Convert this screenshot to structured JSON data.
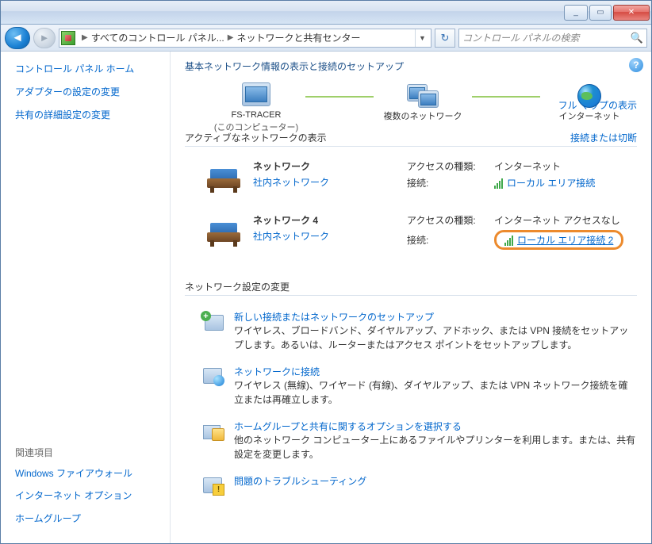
{
  "titlebar": {
    "min": "_",
    "max": "▭",
    "close": "✕"
  },
  "address": {
    "crumb1": "すべてのコントロール パネル...",
    "crumb2": "ネットワークと共有センター",
    "search_placeholder": "コントロール パネルの検索"
  },
  "sidebar": {
    "home": "コントロール パネル ホーム",
    "adapter": "アダプターの設定の変更",
    "sharing": "共有の詳細設定の変更",
    "related_heading": "関連項目",
    "firewall": "Windows ファイアウォール",
    "inetopt": "インターネット オプション",
    "homegroup": "ホームグループ"
  },
  "main": {
    "h1": "基本ネットワーク情報の表示と接続のセットアップ",
    "map": {
      "node1": "FS-TRACER",
      "node1_sub": "(このコンピューター)",
      "node2": "複数のネットワーク",
      "node3": "インターネット",
      "fullmap": "フル マップの表示"
    },
    "active_heading": "アクティブなネットワークの表示",
    "active_link": "接続または切断",
    "net1": {
      "name": "ネットワーク",
      "type": "社内ネットワーク",
      "access_label": "アクセスの種類:",
      "access_val": "インターネット",
      "conn_label": "接続:",
      "conn_link": "ローカル エリア接続"
    },
    "net2": {
      "name": "ネットワーク  4",
      "type": "社内ネットワーク",
      "access_label": "アクセスの種類:",
      "access_val": "インターネット アクセスなし",
      "conn_label": "接続:",
      "conn_link": "ローカル エリア接続 2"
    },
    "settings_heading": "ネットワーク設定の変更",
    "s1": {
      "title": "新しい接続またはネットワークのセットアップ",
      "desc": "ワイヤレス、ブロードバンド、ダイヤルアップ、アドホック、または VPN 接続をセットアップします。あるいは、ルーターまたはアクセス ポイントをセットアップします。"
    },
    "s2": {
      "title": "ネットワークに接続",
      "desc": "ワイヤレス (無線)、ワイヤード (有線)、ダイヤルアップ、または VPN ネットワーク接続を確立または再確立します。"
    },
    "s3": {
      "title": "ホームグループと共有に関するオプションを選択する",
      "desc": "他のネットワーク コンピューター上にあるファイルやプリンターを利用します。または、共有設定を変更します。"
    },
    "s4": {
      "title": "問題のトラブルシューティング"
    }
  }
}
